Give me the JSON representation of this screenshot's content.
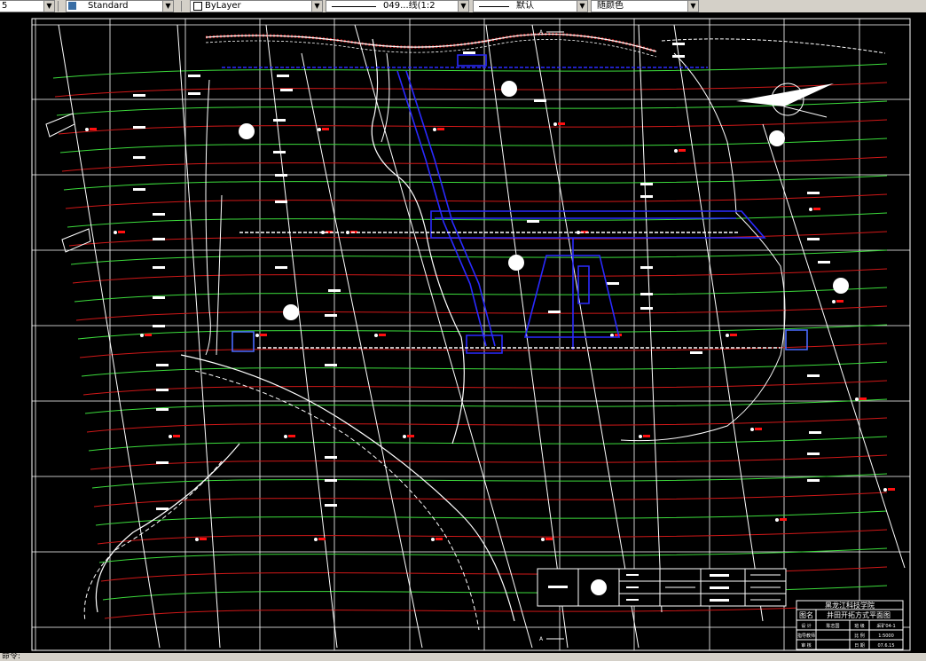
{
  "toolbar": {
    "left_partial": "5",
    "text_style": "Standard",
    "layer": "ByLayer",
    "linetype": "049...线(1:2",
    "lineweight": "默认",
    "color": "随颜色"
  },
  "drawing": {
    "title_block": {
      "school": "黑龙江科技学院",
      "label_name": "图名",
      "drawing_name": "井田开拓方式平面图",
      "row1": [
        "设  计",
        "陈志国",
        "班 级",
        "采矿04-1"
      ],
      "row2": [
        "指导教师",
        "",
        "比 例",
        "1:5000"
      ],
      "row3": [
        "审  核",
        "",
        "日 期",
        "07.6.15"
      ]
    },
    "section_mark_top": "A",
    "section_mark_bottom": "A"
  },
  "status_bar": {
    "text": "命令:"
  },
  "colors": {
    "background": "#000000",
    "contour_green": "#3cdc3c",
    "contour_red": "#d01818",
    "roadway_blue": "#2a2aff",
    "grid_white": "#ffffff",
    "marker_red": "#ff1010"
  }
}
